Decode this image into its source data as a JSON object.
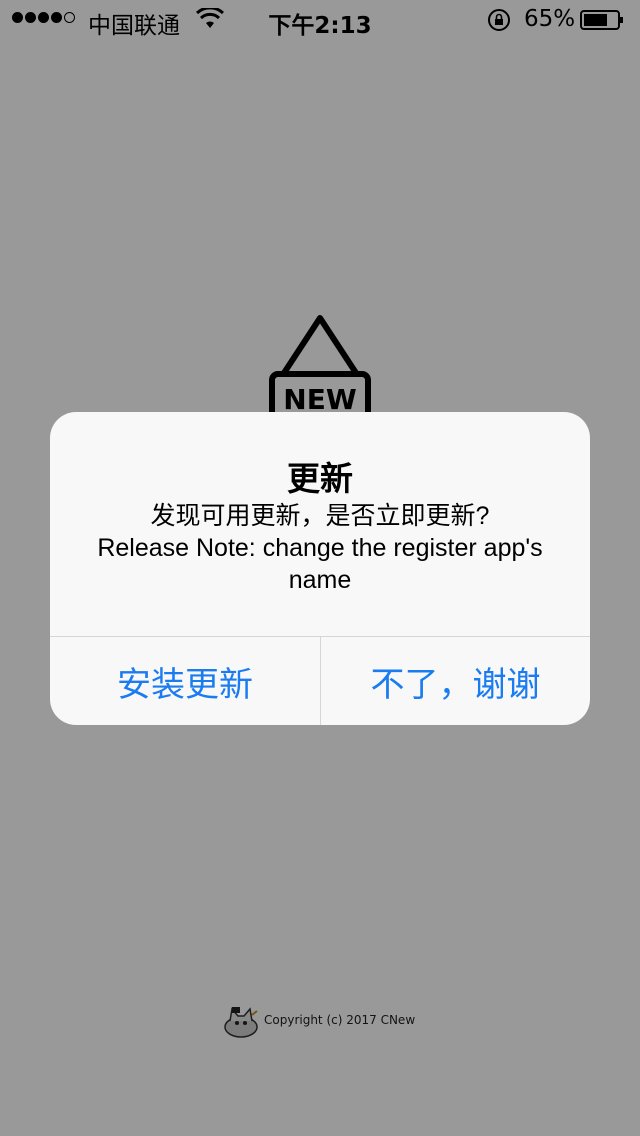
{
  "status_bar": {
    "carrier": "中国联通",
    "time": "下午2:13",
    "battery_percent": "65%",
    "signal_bars_filled": 4,
    "signal_bars_total": 5,
    "icons": [
      "wifi-icon",
      "orientation-lock-icon",
      "battery-icon"
    ]
  },
  "background": {
    "sign_label": "NEW",
    "copyright": "Copyright (c) 2017 CNew"
  },
  "alert": {
    "title": "更新",
    "message": "发现可用更新，是否立即更新?\nRelease Note:  change the register app's name",
    "buttons": {
      "install": "安装更新",
      "dismiss": "不了，谢谢"
    }
  },
  "colors": {
    "accent": "#1a7cf0",
    "alert_bg": "#f8f8f8"
  }
}
